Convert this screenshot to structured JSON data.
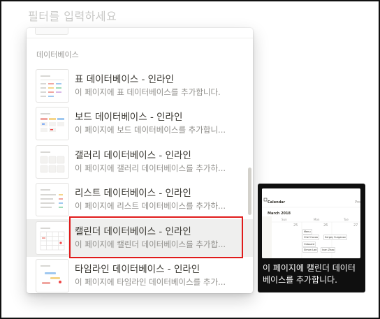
{
  "filter": {
    "placeholder": "필터를 입력하세요"
  },
  "menu": {
    "section_label": "데이터베이스",
    "items": [
      {
        "title": "표 데이터베이스 - 인라인",
        "desc": "이 페이지에 표 데이터베이스를 추가합니다.",
        "icon": "table-thumbnail-icon"
      },
      {
        "title": "보드 데이터베이스 - 인라인",
        "desc": "이 페이지에 보드 데이터베이스를 추가합니...",
        "icon": "board-thumbnail-icon"
      },
      {
        "title": "갤러리 데이터베이스 - 인라인",
        "desc": "이 페이지에 갤러리 데이터베이스를 추가하...",
        "icon": "gallery-thumbnail-icon"
      },
      {
        "title": "리스트 데이터베이스 - 인라인",
        "desc": "이 페이지에 리스트 데이터베이스를 추가하...",
        "icon": "list-thumbnail-icon"
      },
      {
        "title": "캘린더 데이터베이스 - 인라인",
        "desc": "이 페이지에 캘린더 데이터베이스를 추가합...",
        "icon": "calendar-thumbnail-icon"
      },
      {
        "title": "타임라인 데이터베이스 - 인라인",
        "desc": "이 페이지에 타임라인 데이터베이스를 추가...",
        "icon": "timeline-thumbnail-icon"
      }
    ]
  },
  "preview": {
    "text": "이 페이지에 캘린더 데이터베이스를 추가합니다.",
    "image": {
      "header": "Calendar",
      "header_right": "Pro",
      "month": "March 2018",
      "dow": [
        "Sun",
        "Mon",
        "Tue"
      ],
      "nums": [
        "25",
        "26",
        "27"
      ],
      "cards": [
        "Menu",
        "Chef Cocoa",
        "Sergey Surganov",
        "Onboard",
        "Simon Lad",
        "Ivan Zhao"
      ]
    }
  },
  "colors": {
    "highlight": "#e01b1b",
    "tooltip_bg": "#0f0f0f"
  }
}
